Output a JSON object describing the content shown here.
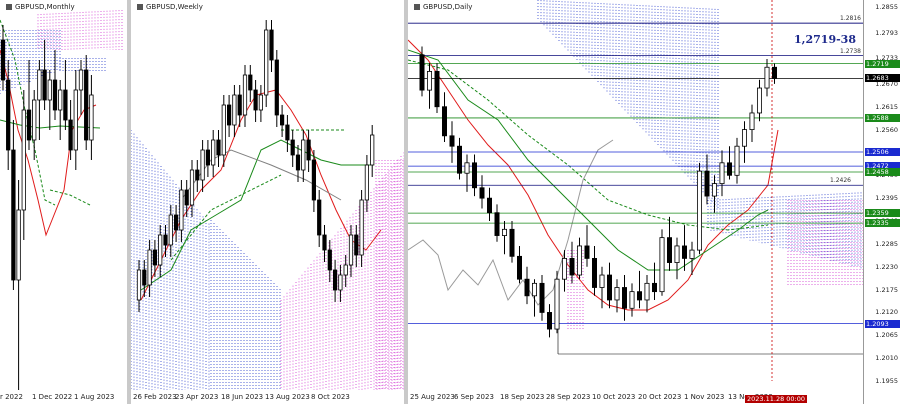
{
  "panels": [
    {
      "id": "monthly",
      "title": "GBPUSD,Monthly",
      "xlabels": [
        "r 2022",
        "1 Dec 2022",
        "1 Aug 2023"
      ]
    },
    {
      "id": "weekly",
      "title": "GBPUSD,Weekly",
      "xlabels": [
        "26 Feb 2023",
        "23 Apr 2023",
        "18 Jun 2023",
        "13 Aug 2023",
        "8 Oct 2023"
      ]
    },
    {
      "id": "daily",
      "title": "GBPUSD,Daily",
      "xlabels": [
        "25 Aug 2023",
        "6 Sep 2023",
        "18 Sep 2023",
        "28 Sep 2023",
        "10 Oct 2023",
        "20 Oct 2023",
        "1 Nov 2023",
        "13 Nov 2023"
      ],
      "date_badge": "2023.11.28 00:00"
    }
  ],
  "annotation": "1,2719-38",
  "colors": {
    "ichimoku_cloud_blue": "#2a3fcc",
    "ichimoku_cloud_pink": "#d23ad2",
    "tenkan": "#e01b1b",
    "kijun": "#1a8a1a",
    "level_green": "#1a8a1a",
    "level_blue": "#1a2ad0",
    "level_darkblue": "#0c0c7a",
    "price_label": "#000000"
  },
  "chart_data": {
    "type": "candlestick",
    "title": "",
    "xlabel": "",
    "ylabel": "",
    "ylim": [
      1.1955,
      1.2855
    ],
    "y_ticks": [
      "1.2855",
      "1.2793",
      "1.2733",
      "1.2670",
      "1.2615",
      "1.2560",
      "1.2450",
      "1.2395",
      "1.2340",
      "1.2285",
      "1.2230",
      "1.2175",
      "1.2120",
      "1.2065",
      "1.2010",
      "1.1955"
    ],
    "levels": [
      {
        "value": "1.2816",
        "label": "1.2816",
        "style": "line-text",
        "color": "#0c0c7a"
      },
      {
        "value": "1.2738",
        "label": "1.2738",
        "style": "line-text",
        "color": "#0c0c7a"
      },
      {
        "value": "1.2719",
        "label": "1.2719",
        "style": "box",
        "color": "#1a8a1a"
      },
      {
        "value": "1.2683",
        "label": "1.2683",
        "style": "box",
        "color": "#000000"
      },
      {
        "value": "1.2588",
        "label": "1.2588",
        "style": "box",
        "color": "#1a8a1a"
      },
      {
        "value": "1.2506",
        "label": "1.2506",
        "style": "box",
        "color": "#1a2ad0"
      },
      {
        "value": "1.2472",
        "label": "1.2472",
        "style": "box",
        "color": "#1a2ad0"
      },
      {
        "value": "1.2458",
        "label": "1.2458",
        "style": "box",
        "color": "#1a8a1a"
      },
      {
        "value": "1.2426",
        "label": "1.2426",
        "style": "line-text",
        "color": "#0c0c7a"
      },
      {
        "value": "1.2359",
        "label": "1.2359",
        "style": "box",
        "color": "#1a8a1a"
      },
      {
        "value": "1.2335",
        "label": "1.2335",
        "style": "box",
        "color": "#1a8a1a"
      },
      {
        "value": "1.2093",
        "label": "1.2093",
        "style": "box",
        "color": "#1a2ad0"
      }
    ],
    "series": [
      {
        "values": [
          [
            1.274,
            1.276,
            1.264,
            1.2655
          ],
          [
            1.2655,
            1.272,
            1.261,
            1.27
          ],
          [
            1.27,
            1.272,
            1.26,
            1.2615
          ],
          [
            1.2615,
            1.265,
            1.253,
            1.2545
          ],
          [
            1.2545,
            1.258,
            1.248,
            1.252
          ],
          [
            1.252,
            1.254,
            1.244,
            1.2455
          ],
          [
            1.2455,
            1.25,
            1.241,
            1.248
          ],
          [
            1.248,
            1.25,
            1.24,
            1.242
          ],
          [
            1.242,
            1.245,
            1.237,
            1.2395
          ],
          [
            1.2395,
            1.242,
            1.234,
            1.236
          ],
          [
            1.236,
            1.238,
            1.229,
            1.2305
          ],
          [
            1.2305,
            1.234,
            1.226,
            1.232
          ],
          [
            1.232,
            1.234,
            1.224,
            1.2255
          ],
          [
            1.2255,
            1.228,
            1.219,
            1.22
          ],
          [
            1.22,
            1.223,
            1.214,
            1.216
          ],
          [
            1.216,
            1.22,
            1.211,
            1.219
          ],
          [
            1.219,
            1.221,
            1.21,
            1.212
          ],
          [
            1.212,
            1.214,
            1.206,
            1.208
          ],
          [
            1.208,
            1.222,
            1.207,
            1.22
          ],
          [
            1.22,
            1.227,
            1.217,
            1.225
          ],
          [
            1.225,
            1.229,
            1.219,
            1.221
          ],
          [
            1.221,
            1.23,
            1.22,
            1.228
          ],
          [
            1.228,
            1.233,
            1.223,
            1.225
          ],
          [
            1.225,
            1.228,
            1.216,
            1.218
          ],
          [
            1.218,
            1.223,
            1.213,
            1.221
          ],
          [
            1.221,
            1.224,
            1.213,
            1.215
          ],
          [
            1.215,
            1.22,
            1.212,
            1.218
          ],
          [
            1.218,
            1.221,
            1.21,
            1.213
          ],
          [
            1.213,
            1.219,
            1.211,
            1.217
          ],
          [
            1.217,
            1.222,
            1.213,
            1.215
          ],
          [
            1.215,
            1.221,
            1.212,
            1.219
          ],
          [
            1.219,
            1.224,
            1.215,
            1.217
          ],
          [
            1.217,
            1.232,
            1.216,
            1.23
          ],
          [
            1.23,
            1.235,
            1.222,
            1.224
          ],
          [
            1.224,
            1.23,
            1.22,
            1.228
          ],
          [
            1.228,
            1.233,
            1.222,
            1.225
          ],
          [
            1.225,
            1.229,
            1.221,
            1.227
          ],
          [
            1.227,
            1.248,
            1.226,
            1.246
          ],
          [
            1.246,
            1.25,
            1.238,
            1.24
          ],
          [
            1.24,
            1.245,
            1.236,
            1.243
          ],
          [
            1.243,
            1.251,
            1.24,
            1.248
          ],
          [
            1.248,
            1.252,
            1.244,
            1.245
          ],
          [
            1.245,
            1.254,
            1.243,
            1.252
          ],
          [
            1.252,
            1.258,
            1.248,
            1.256
          ],
          [
            1.256,
            1.262,
            1.253,
            1.26
          ],
          [
            1.26,
            1.268,
            1.258,
            1.266
          ],
          [
            1.266,
            1.273,
            1.264,
            1.271
          ],
          [
            1.271,
            1.2719,
            1.267,
            1.2683
          ]
        ]
      }
    ]
  }
}
